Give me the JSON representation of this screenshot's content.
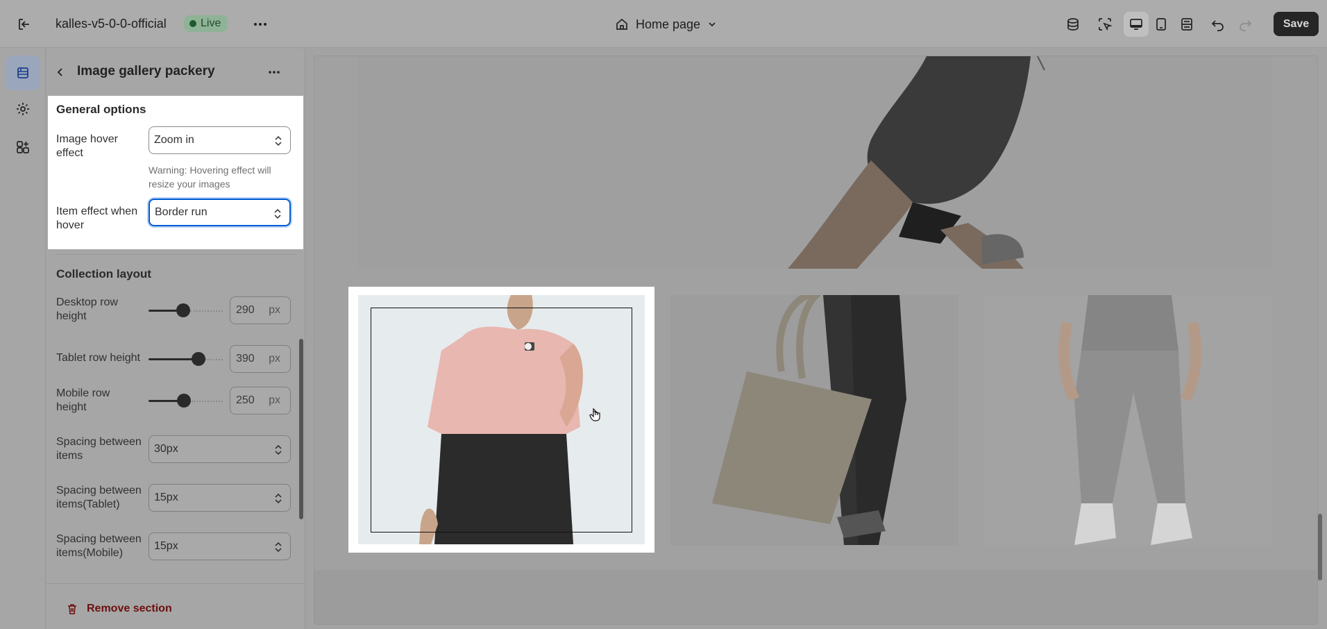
{
  "topbar": {
    "store_name": "kalles-v5-0-0-official",
    "live_label": "Live",
    "page_name": "Home page",
    "save_label": "Save"
  },
  "panel": {
    "title": "Image gallery packery",
    "general_options_title": "General options",
    "image_hover_label": "Image hover effect",
    "image_hover_value": "Zoom in",
    "image_hover_help": "Warning: Hovering effect will resize your images",
    "item_effect_label": "Item effect when hover",
    "item_effect_value": "Border run",
    "collection_layout_title": "Collection layout",
    "desktop_row_label": "Desktop row height",
    "desktop_row_value": "290",
    "tablet_row_label": "Tablet row height",
    "tablet_row_value": "390",
    "mobile_row_label": "Mobile row height",
    "mobile_row_value": "250",
    "unit_px": "px",
    "spacing_label": "Spacing between items",
    "spacing_value": "30px",
    "spacing_tablet_label": "Spacing between items(Tablet)",
    "spacing_tablet_value": "15px",
    "spacing_mobile_label": "Spacing between items(Mobile)",
    "spacing_mobile_value": "15px",
    "remove_label": "Remove section"
  },
  "colors": {
    "accent": "#005bd3",
    "danger": "#6d0f0f",
    "overlay": "#a3a3a3"
  }
}
